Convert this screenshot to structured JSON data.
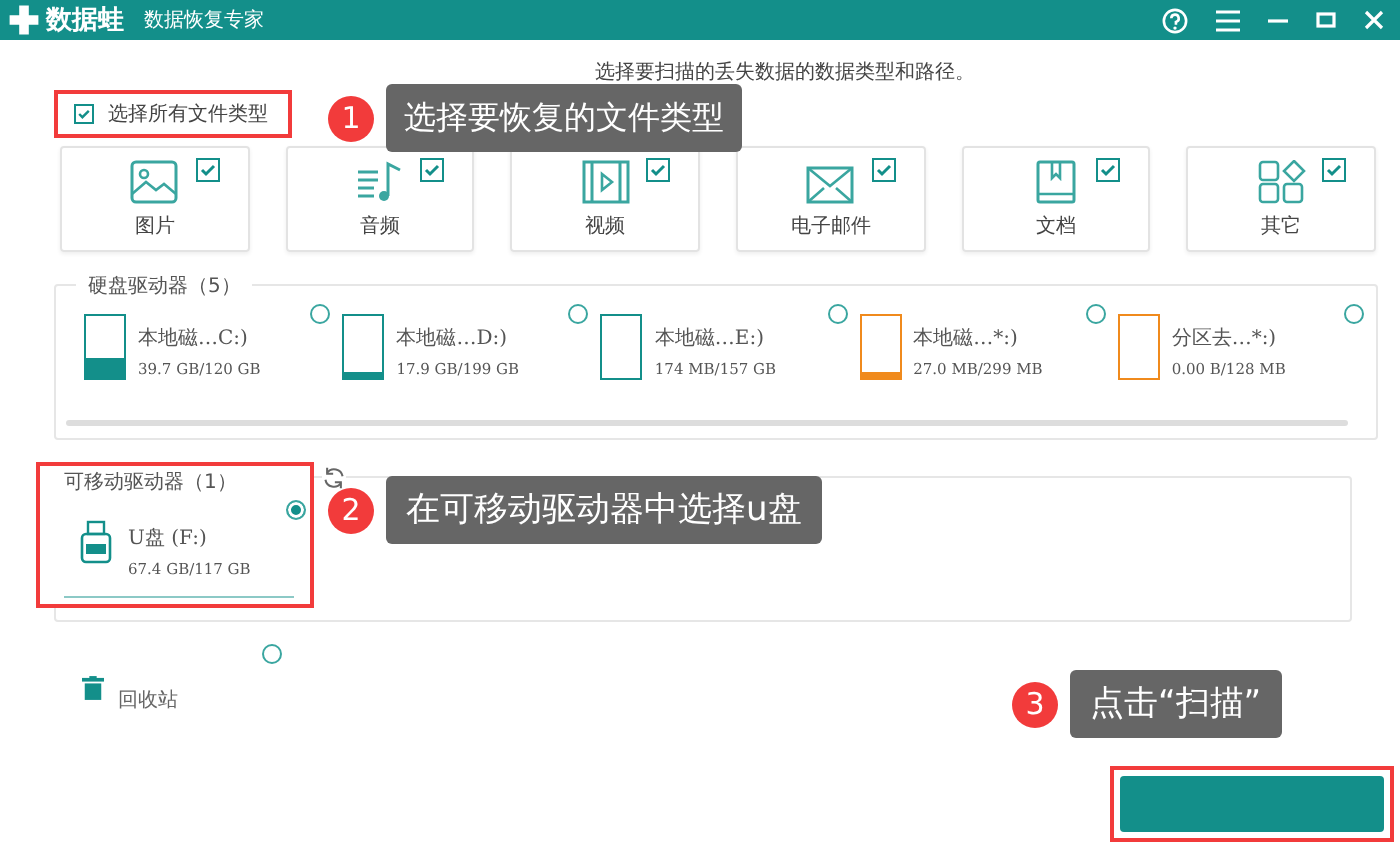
{
  "app": {
    "name": "数据蛙",
    "subtitle": "数据恢复专家"
  },
  "instruction": "选择要扫描的丢失数据的数据类型和路径。",
  "select_all": {
    "label": "选择所有文件类型",
    "checked": true
  },
  "file_types": [
    {
      "label": "图片",
      "checked": true,
      "kind": "image"
    },
    {
      "label": "音频",
      "checked": true,
      "kind": "audio"
    },
    {
      "label": "视频",
      "checked": true,
      "kind": "video"
    },
    {
      "label": "电子邮件",
      "checked": true,
      "kind": "mail"
    },
    {
      "label": "文档",
      "checked": true,
      "kind": "document"
    },
    {
      "label": "其它",
      "checked": true,
      "kind": "other"
    }
  ],
  "hard_drives": {
    "title": "硬盘驱动器（5）",
    "drives": [
      {
        "name": "本地磁…C:)",
        "size": "39.7 GB/120 GB",
        "level": 0.33,
        "color": "#138f8a",
        "selected": false
      },
      {
        "name": "本地磁…D:)",
        "size": "17.9 GB/199 GB",
        "level": 0.09,
        "color": "#138f8a",
        "selected": false
      },
      {
        "name": "本地磁…E:)",
        "size": "174 MB/157 GB",
        "level": 0,
        "color": "#138f8a",
        "selected": false
      },
      {
        "name": "本地磁…*:)",
        "size": "27.0 MB/299 MB",
        "level": 0.09,
        "color": "#f08a1c",
        "selected": false
      },
      {
        "name": "分区去…*:)",
        "size": "0.00  B/128 MB",
        "level": 0,
        "color": "#f08a1c",
        "selected": false
      }
    ]
  },
  "removable": {
    "title": "可移动驱动器（1）",
    "drives": [
      {
        "name": "U盘 (F:)",
        "size": "67.4 GB/117 GB",
        "selected": true
      }
    ]
  },
  "recycle_bin": {
    "label": "回收站",
    "selected": false
  },
  "callouts": [
    {
      "number": "1",
      "text": "选择要恢复的文件类型"
    },
    {
      "number": "2",
      "text": "在可移动驱动器中选择u盘"
    },
    {
      "number": "3",
      "text": "点击“扫描”"
    }
  ]
}
